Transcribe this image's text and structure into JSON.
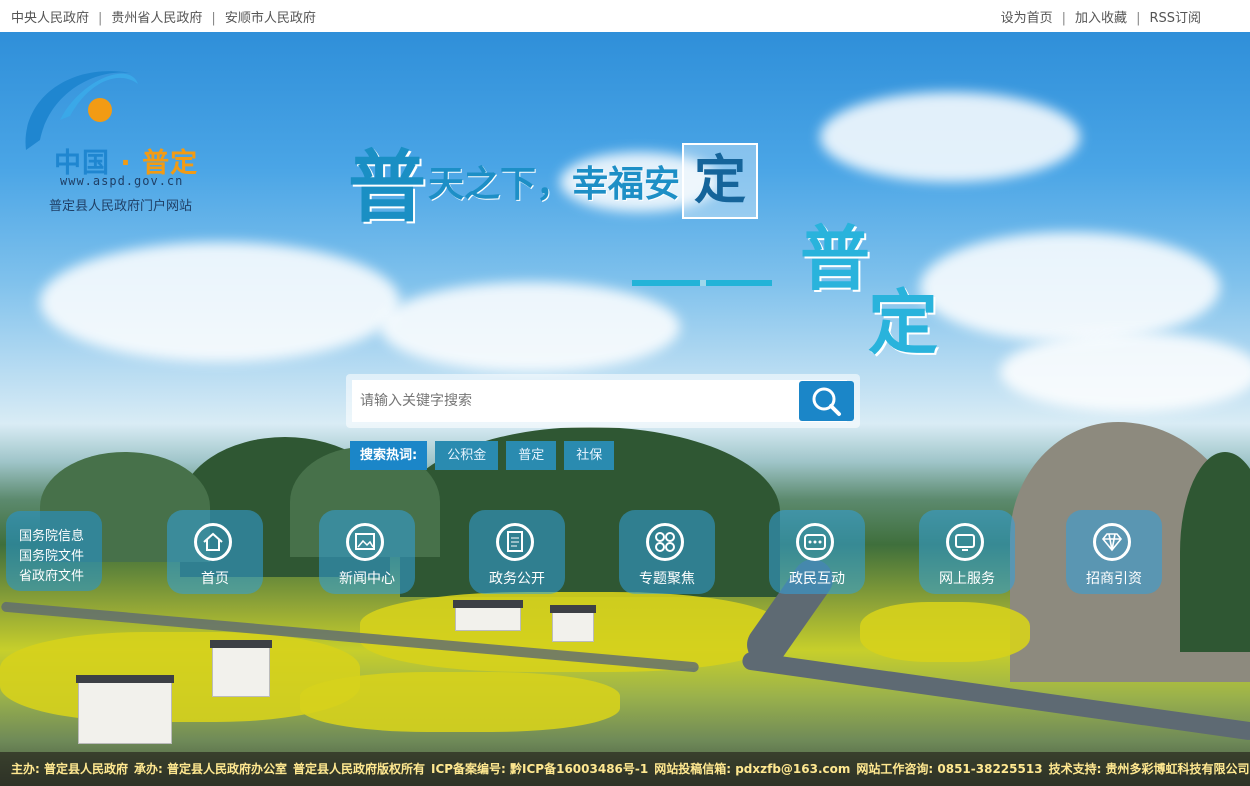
{
  "topbar": {
    "left_links": [
      "中央人民政府",
      "贵州省人民政府",
      "安顺市人民政府"
    ],
    "right_links": [
      "设为首页",
      "加入收藏",
      "RSS订阅"
    ],
    "separator": "|"
  },
  "logo": {
    "brand_part1": "中国",
    "brand_dot": "·",
    "brand_part2": "普定",
    "url": "www.aspd.gov.cn",
    "site_name": "普定县人民政府门户网站"
  },
  "slogan": {
    "big_char": "普",
    "line1": "天之下，幸福安",
    "boxed_char": "定",
    "line2_char1": "普",
    "line2_char2": "定"
  },
  "search": {
    "placeholder": "请输入关键字搜索",
    "hot_label": "搜索热词:",
    "hot_keywords": [
      "公积金",
      "普定",
      "社保"
    ]
  },
  "side_info": {
    "items": [
      "国务院信息",
      "国务院文件",
      "省政府文件"
    ]
  },
  "nav": {
    "items": [
      {
        "label": "首页",
        "icon": "home-icon"
      },
      {
        "label": "新闻中心",
        "icon": "image-icon"
      },
      {
        "label": "政务公开",
        "icon": "document-icon"
      },
      {
        "label": "专题聚焦",
        "icon": "grid-icon"
      },
      {
        "label": "政民互动",
        "icon": "chat-icon"
      },
      {
        "label": "网上服务",
        "icon": "monitor-icon"
      },
      {
        "label": "招商引资",
        "icon": "diamond-icon"
      }
    ]
  },
  "footer": {
    "sponsor": "主办: 普定县人民政府",
    "organizer": "承办: 普定县人民政府办公室",
    "copyright": "普定县人民政府版权所有",
    "icp": "ICP备案编号: 黔ICP备16003486号-1",
    "email": "网站投稿信箱: pdxzfb@163.com",
    "hotline": "网站工作咨询: 0851-38225513",
    "tech": "技术支持: 贵州多彩博虹科技有限公司"
  },
  "colors": {
    "accent_blue": "#1b86c8",
    "logo_orange": "#f29b14",
    "footer_text": "#ffe890"
  }
}
